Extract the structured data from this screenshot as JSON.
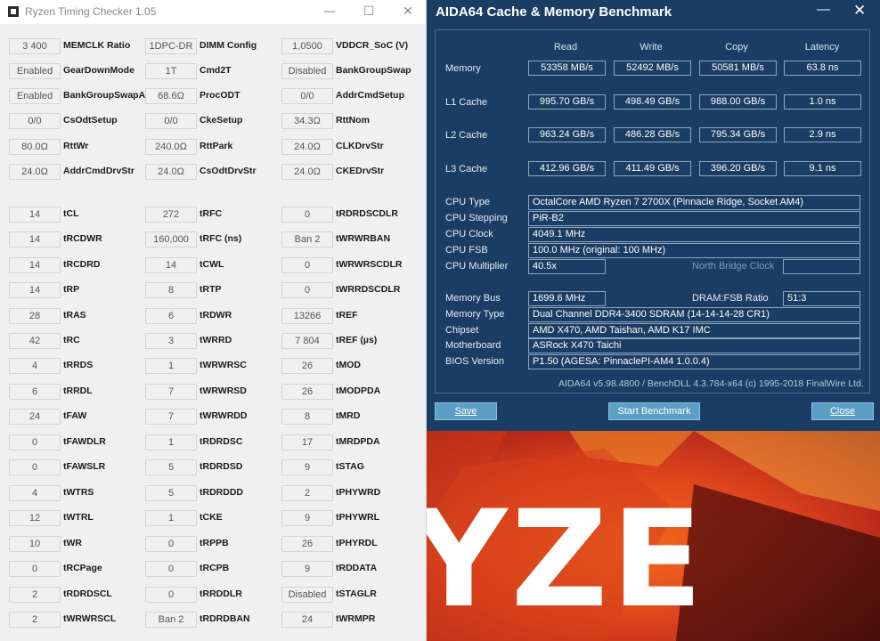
{
  "rtc": {
    "title": "Ryzen Timing Checker 1.05",
    "controls": {
      "minimize": "—",
      "maximize": "☐",
      "close": "✕"
    },
    "columns": [
      [
        {
          "value": "3 400",
          "label": "MEMCLK Ratio"
        },
        {
          "value": "Enabled",
          "label": "GearDownMode"
        },
        {
          "value": "Enabled",
          "label": "BankGroupSwapAlt"
        },
        {
          "value": "0/0",
          "label": "CsOdtSetup"
        },
        {
          "value": "80.0Ω",
          "label": "RttWr"
        },
        {
          "value": "24.0Ω",
          "label": "AddrCmdDrvStr"
        },
        {
          "value": "14",
          "label": "tCL"
        },
        {
          "value": "14",
          "label": "tRCDWR"
        },
        {
          "value": "14",
          "label": "tRCDRD"
        },
        {
          "value": "14",
          "label": "tRP"
        },
        {
          "value": "28",
          "label": "tRAS"
        },
        {
          "value": "42",
          "label": "tRC"
        },
        {
          "value": "4",
          "label": "tRRDS"
        },
        {
          "value": "6",
          "label": "tRRDL"
        },
        {
          "value": "24",
          "label": "tFAW"
        },
        {
          "value": "0",
          "label": "tFAWDLR"
        },
        {
          "value": "0",
          "label": "tFAWSLR"
        },
        {
          "value": "4",
          "label": "tWTRS"
        },
        {
          "value": "12",
          "label": "tWTRL"
        },
        {
          "value": "10",
          "label": "tWR"
        },
        {
          "value": "0",
          "label": "tRCPage"
        },
        {
          "value": "2",
          "label": "tRDRDSCL"
        },
        {
          "value": "2",
          "label": "tWRWRSCL"
        }
      ],
      [
        {
          "value": "1DPC-DR",
          "label": "DIMM Config"
        },
        {
          "value": "1T",
          "label": "Cmd2T"
        },
        {
          "value": "68.6Ω",
          "label": "ProcODT"
        },
        {
          "value": "0/0",
          "label": "CkeSetup"
        },
        {
          "value": "240.0Ω",
          "label": "RttPark"
        },
        {
          "value": "24.0Ω",
          "label": "CsOdtDrvStr"
        },
        {
          "value": "272",
          "label": "tRFC"
        },
        {
          "value": "160,000",
          "label": "tRFC (ns)"
        },
        {
          "value": "14",
          "label": "tCWL"
        },
        {
          "value": "8",
          "label": "tRTP"
        },
        {
          "value": "6",
          "label": "tRDWR"
        },
        {
          "value": "3",
          "label": "tWRRD"
        },
        {
          "value": "1",
          "label": "tWRWRSC"
        },
        {
          "value": "7",
          "label": "tWRWRSD"
        },
        {
          "value": "7",
          "label": "tWRWRDD"
        },
        {
          "value": "1",
          "label": "tRDRDSC"
        },
        {
          "value": "5",
          "label": "tRDRDSD"
        },
        {
          "value": "5",
          "label": "tRDRDDD"
        },
        {
          "value": "1",
          "label": "tCKE"
        },
        {
          "value": "0",
          "label": "tRPPB"
        },
        {
          "value": "0",
          "label": "tRCPB"
        },
        {
          "value": "0",
          "label": "tRRDDLR"
        },
        {
          "value": "Ban 2",
          "label": "tRDRDBAN"
        }
      ],
      [
        {
          "value": "1,0500",
          "label": "VDDCR_SoC (V)"
        },
        {
          "value": "Disabled",
          "label": "BankGroupSwap"
        },
        {
          "value": "0/0",
          "label": "AddrCmdSetup"
        },
        {
          "value": "34.3Ω",
          "label": "RttNom"
        },
        {
          "value": "24.0Ω",
          "label": "CLKDrvStr"
        },
        {
          "value": "24.0Ω",
          "label": "CKEDrvStr"
        },
        {
          "value": "0",
          "label": "tRDRDSCDLR"
        },
        {
          "value": "Ban 2",
          "label": "tWRWRBAN"
        },
        {
          "value": "0",
          "label": "tWRWRSCDLR"
        },
        {
          "value": "0",
          "label": "tWRRDSCDLR"
        },
        {
          "value": "13266",
          "label": "tREF"
        },
        {
          "value": "7 804",
          "label": "tREF (µs)"
        },
        {
          "value": "26",
          "label": "tMOD"
        },
        {
          "value": "26",
          "label": "tMODPDA"
        },
        {
          "value": "8",
          "label": "tMRD"
        },
        {
          "value": "17",
          "label": "tMRDPDA"
        },
        {
          "value": "9",
          "label": "tSTAG"
        },
        {
          "value": "2",
          "label": "tPHYWRD"
        },
        {
          "value": "9",
          "label": "tPHYWRL"
        },
        {
          "value": "26",
          "label": "tPHYRDL"
        },
        {
          "value": "9",
          "label": "tRDDATA"
        },
        {
          "value": "Disabled",
          "label": "tSTAGLR"
        },
        {
          "value": "24",
          "label": "tWRMPR"
        }
      ]
    ]
  },
  "aida": {
    "title": "AIDA64 Cache & Memory Benchmark",
    "controls": {
      "minimize": "—",
      "close": "✕"
    },
    "headers": [
      "Read",
      "Write",
      "Copy",
      "Latency"
    ],
    "rows": [
      {
        "label": "Memory",
        "values": [
          "53358 MB/s",
          "52492 MB/s",
          "50581 MB/s",
          "63.8 ns"
        ]
      },
      {
        "label": "L1 Cache",
        "values": [
          "995.70 GB/s",
          "498.49 GB/s",
          "988.00 GB/s",
          "1.0 ns"
        ]
      },
      {
        "label": "L2 Cache",
        "values": [
          "963.24 GB/s",
          "486.28 GB/s",
          "795.34 GB/s",
          "2.9 ns"
        ]
      },
      {
        "label": "L3 Cache",
        "values": [
          "412.96 GB/s",
          "411.49 GB/s",
          "396.20 GB/s",
          "9.1 ns"
        ]
      }
    ],
    "info": [
      {
        "label": "CPU Type",
        "value": "OctalCore AMD Ryzen 7 2700X  (Pinnacle Ridge, Socket AM4)"
      },
      {
        "label": "CPU Stepping",
        "value": "PiR-B2"
      },
      {
        "label": "CPU Clock",
        "value": "4049.1 MHz"
      },
      {
        "label": "CPU FSB",
        "value": "100.0 MHz  (original: 100 MHz)"
      },
      {
        "label": "CPU Multiplier",
        "value": "40.5x"
      }
    ],
    "north_bridge_label": "North Bridge Clock",
    "north_bridge_value": "",
    "info2": [
      {
        "label": "Memory Bus",
        "value": "1699.6 MHz"
      },
      {
        "label": "Memory Type",
        "value": "Dual Channel DDR4-3400 SDRAM  (14-14-14-28 CR1)"
      },
      {
        "label": "Chipset",
        "value": "AMD X470, AMD Taishan, AMD K17 IMC"
      },
      {
        "label": "Motherboard",
        "value": "ASRock X470 Taichi"
      },
      {
        "label": "BIOS Version",
        "value": "P1.50  (AGESA: PinnaclePI-AM4 1.0.0.4)"
      }
    ],
    "dram_fsb_label": "DRAM:FSB Ratio",
    "dram_fsb_value": "51:3",
    "footer": "AIDA64 v5.98.4800 / BenchDLL 4.3.784-x64  (c) 1995-2018 FinalWire Ltd.",
    "buttons": {
      "save": "Save",
      "start": "Start Benchmark",
      "close": "Close"
    }
  },
  "wallpaper": {
    "text": "YZE"
  },
  "colors": {
    "aida_bg": "#1b3d63",
    "aida_button": "#5b9fc4",
    "rtc_bg": "#f0f0f0",
    "wallpaper_orange": "#e8581c"
  }
}
